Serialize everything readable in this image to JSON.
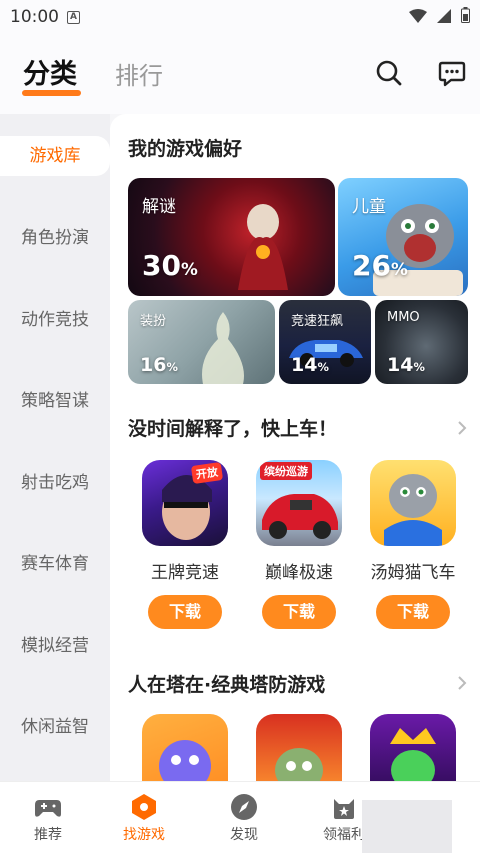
{
  "status_bar": {
    "time": "10:00",
    "badge": "A"
  },
  "header": {
    "tabs": [
      {
        "label": "分类"
      },
      {
        "label": "排行"
      }
    ]
  },
  "sidebar": {
    "items": [
      {
        "label": "游戏库"
      },
      {
        "label": "角色扮演"
      },
      {
        "label": "动作竞技"
      },
      {
        "label": "策略智谋"
      },
      {
        "label": "射击吃鸡"
      },
      {
        "label": "赛车体育"
      },
      {
        "label": "模拟经营"
      },
      {
        "label": "休闲益智"
      }
    ]
  },
  "prefs": {
    "title": "我的游戏偏好",
    "tiles": [
      {
        "label": "解谜",
        "percent": "30"
      },
      {
        "label": "儿童",
        "percent": "26"
      },
      {
        "label": "装扮",
        "percent": "16"
      },
      {
        "label": "竞速狂飙",
        "percent": "14"
      },
      {
        "label": "MMO",
        "percent": "14"
      }
    ],
    "percent_unit": "%"
  },
  "section1": {
    "title": "没时间解释了，快上车！",
    "games": [
      {
        "name": "王牌竞速",
        "button": "下载",
        "icon_text": "开放"
      },
      {
        "name": "巅峰极速",
        "button": "下载",
        "icon_text": "缤纷巡游"
      },
      {
        "name": "汤姆猫飞车",
        "button": "下载"
      }
    ]
  },
  "section2": {
    "title": "人在塔在·经典塔防游戏"
  },
  "bottom_nav": [
    {
      "label": "推荐"
    },
    {
      "label": "找游戏"
    },
    {
      "label": "发现"
    },
    {
      "label": "领福利"
    }
  ],
  "colors": {
    "accent": "#ff7a1a",
    "button": "#ff8a1e"
  }
}
